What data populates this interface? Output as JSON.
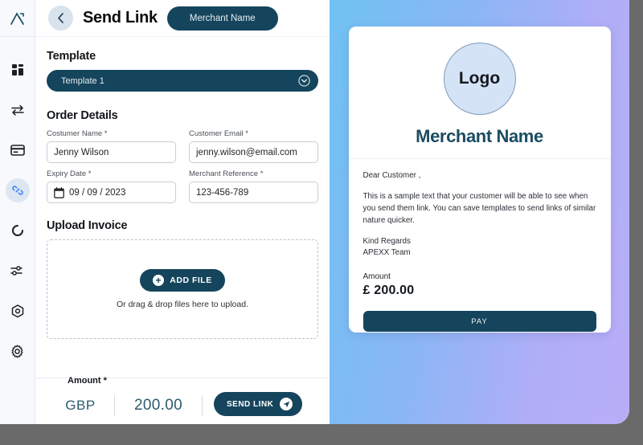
{
  "brand": {
    "logo_name": "APEXX",
    "accent_dark": "#15455c",
    "accent_blue": "#3b82f6",
    "gradient_from": "#6fc2f2",
    "gradient_to": "#b9aef8"
  },
  "sidebar": {
    "items": [
      {
        "name": "dashboard",
        "icon": "grid-icon",
        "active": false
      },
      {
        "name": "transfers",
        "icon": "transfer-arrows-icon",
        "active": false
      },
      {
        "name": "cards",
        "icon": "credit-card-icon",
        "active": false
      },
      {
        "name": "links",
        "icon": "link-icon",
        "active": true
      },
      {
        "name": "refresh",
        "icon": "refresh-circle-icon",
        "active": false
      },
      {
        "name": "controls",
        "icon": "sliders-icon",
        "active": false
      },
      {
        "name": "security",
        "icon": "hexagon-target-icon",
        "active": false
      },
      {
        "name": "settings",
        "icon": "gear-icon",
        "active": false
      }
    ]
  },
  "header": {
    "back_label": "Back",
    "title": "Send Link",
    "merchant_pill": "Merchant Name"
  },
  "form": {
    "template_section_title": "Template",
    "template_selected": "Template 1",
    "template_options": [
      "Template 1"
    ],
    "order_section_title": "Order Details",
    "fields": [
      {
        "label": "Costumer Name *",
        "value": "Jenny Wilson",
        "icon": null
      },
      {
        "label": "Customer Email *",
        "value": "jenny.wilson@email.com",
        "icon": null
      },
      {
        "label": "Expiry Date *",
        "value": "09 / 09 / 2023",
        "icon": "calendar-icon"
      },
      {
        "label": "Merchant Reference *",
        "value": "123-456-789",
        "icon": null
      }
    ],
    "upload_section_title": "Upload Invoice",
    "add_file_label": "ADD FILE",
    "drop_hint": "Or drag & drop files here to upload."
  },
  "bottom": {
    "amount_label": "Amount *",
    "currency": "GBP",
    "amount": "200.00",
    "send_label": "SEND LINK"
  },
  "preview": {
    "logo_text": "Logo",
    "merchant_name": "Merchant Name",
    "greeting": "Dear Customer ,",
    "body_line_1": "This is a sample text that your customer will be able to see when",
    "body_line_2": "you send them link. You can save templates to send links of similar",
    "body_line_3": "nature quicker.",
    "signoff_line_1": "Kind Regards",
    "signoff_line_2": "APEXX Team",
    "amount_label": "Amount",
    "amount_value": "£ 200.00",
    "pay_label": "PAY"
  }
}
